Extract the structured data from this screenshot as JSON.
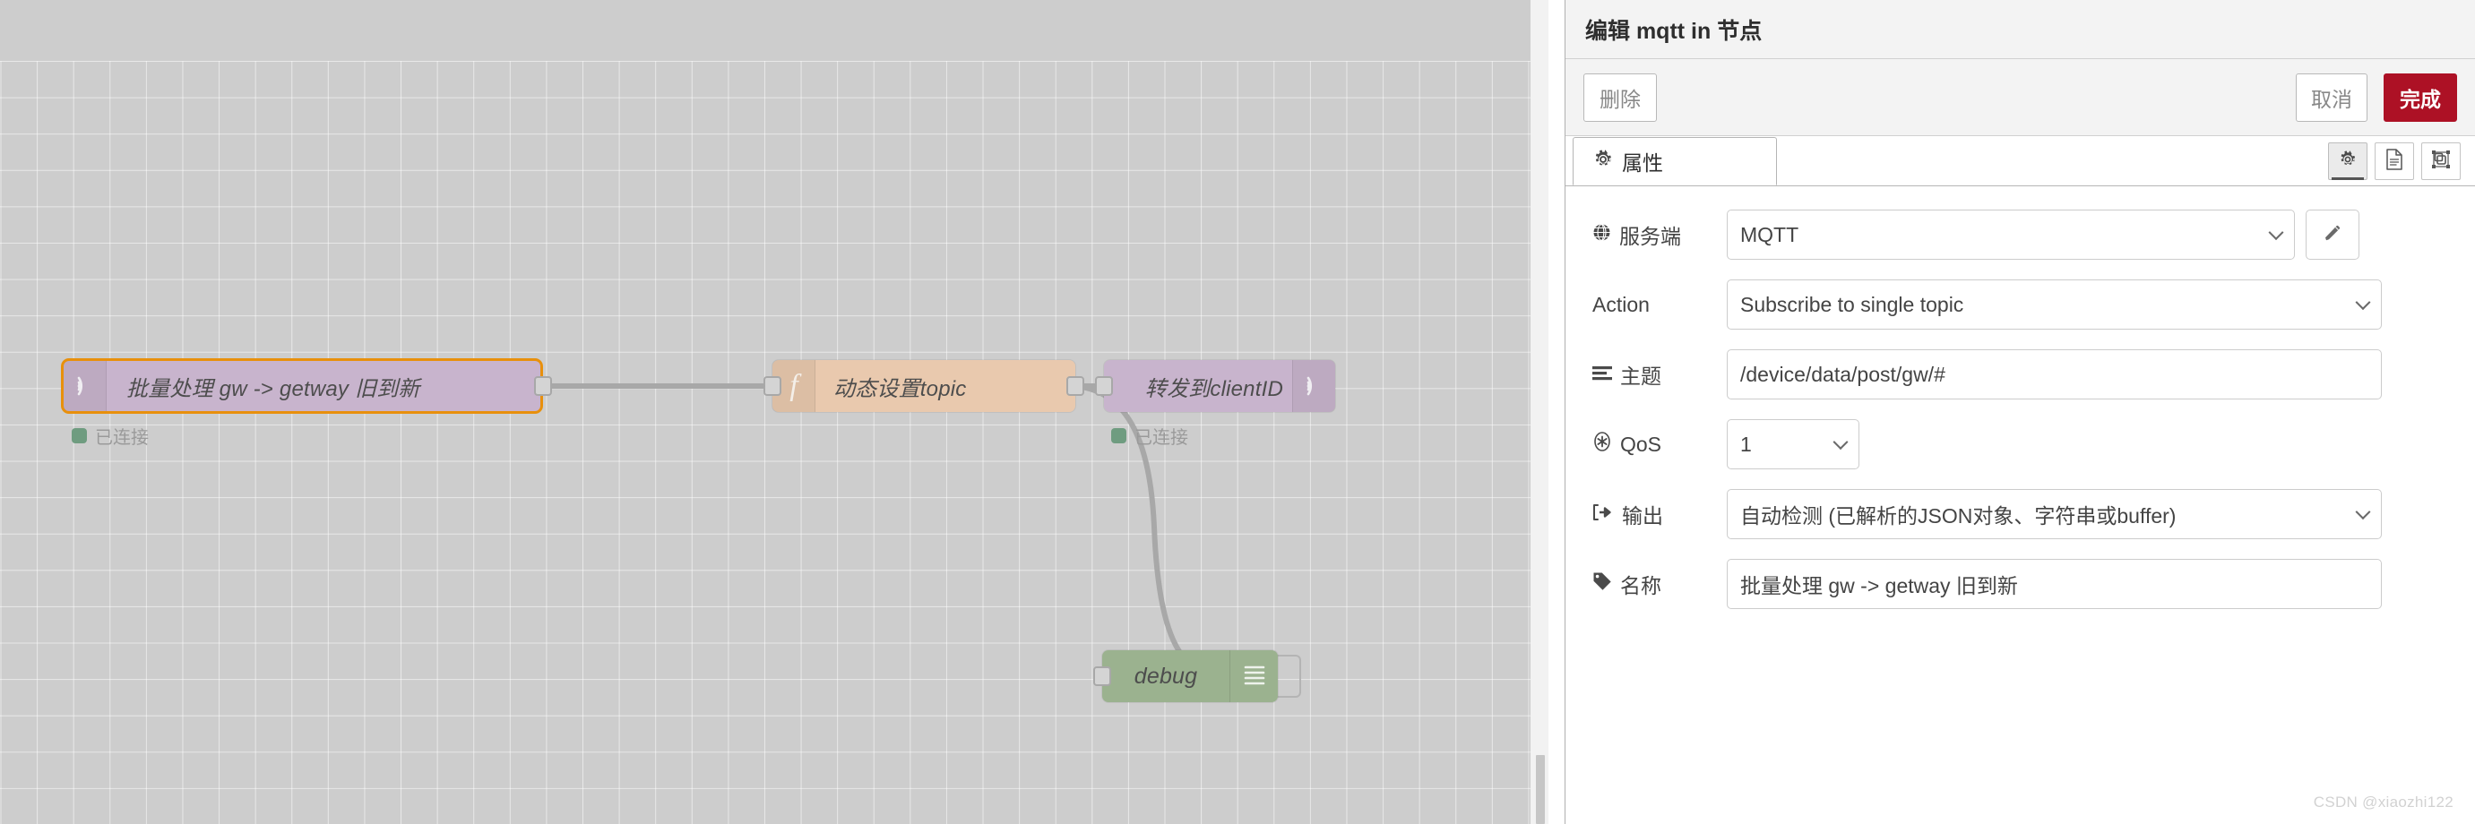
{
  "canvas": {
    "nodes": [
      {
        "id": "mqtt-in",
        "label": "批量处理 gw -> getway 旧到新",
        "icon": "mqtt-signal-icon",
        "type": "mqtt in",
        "selected": true,
        "color": "#c8b4cd",
        "selection_color": "#e8900c",
        "status": "已连接",
        "status_color": "#6f9c80"
      },
      {
        "id": "function",
        "label": "动态设置topic",
        "icon": "function-f-icon",
        "type": "function",
        "selected": false,
        "color": "#e9c9ae"
      },
      {
        "id": "mqtt-out",
        "label": "转发到clientID",
        "icon": "mqtt-signal-icon",
        "type": "mqtt out",
        "selected": false,
        "color": "#c8b4cd",
        "status": "已连接",
        "status_color": "#6f9c80"
      },
      {
        "id": "debug",
        "label": "debug",
        "icon": "debug-lines-icon",
        "type": "debug",
        "selected": false,
        "color": "#9bb28f"
      }
    ]
  },
  "panel": {
    "title": "编辑 mqtt in 节点",
    "buttons": {
      "delete": "删除",
      "cancel": "取消",
      "done": "完成"
    },
    "tabs": [
      {
        "label": "属性",
        "icon": "gear-icon",
        "active": true
      }
    ],
    "tab_tools": [
      {
        "name": "gear-icon",
        "active": true
      },
      {
        "name": "description-icon",
        "active": false
      },
      {
        "name": "appearance-icon",
        "active": false
      }
    ],
    "form": {
      "server": {
        "label": "服务端",
        "icon": "globe-icon",
        "value": "MQTT",
        "edit_button_icon": "pencil-icon"
      },
      "action": {
        "label": "Action",
        "icon": "",
        "value": "Subscribe to single topic"
      },
      "topic": {
        "label": "主题",
        "icon": "topic-lines-icon",
        "value": "/device/data/post/gw/#"
      },
      "qos": {
        "label": "QoS",
        "icon": "qos-asterisk-icon",
        "value": "1"
      },
      "output": {
        "label": "输出",
        "icon": "output-arrow-icon",
        "value": "自动检测 (已解析的JSON对象、字符串或buffer)"
      },
      "name": {
        "label": "名称",
        "icon": "tag-icon",
        "value": "批量处理 gw -> getway 旧到新"
      }
    },
    "accent_color": "#ad1125"
  },
  "watermark": "CSDN @xiaozhi122"
}
